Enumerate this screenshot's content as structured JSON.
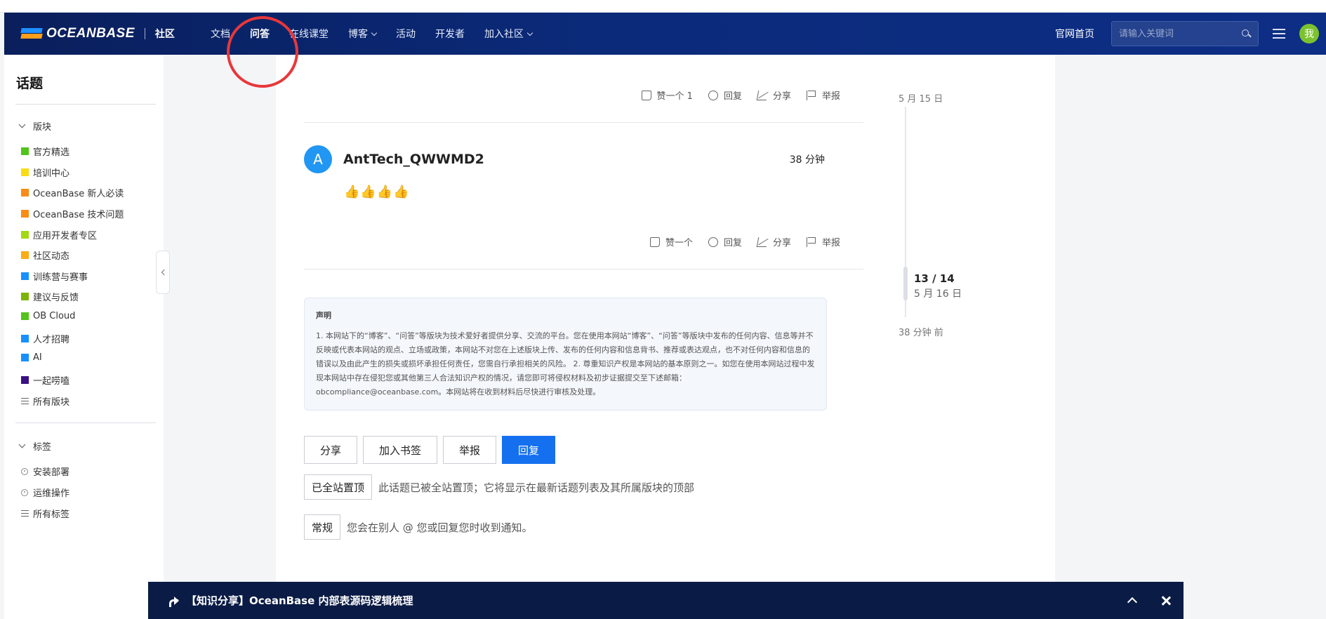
{
  "header": {
    "logo_text": "OCEANBASE",
    "community_label": "社区",
    "nav": [
      {
        "label": "文档",
        "dropdown": false,
        "active": false
      },
      {
        "label": "问答",
        "dropdown": false,
        "active": true
      },
      {
        "label": "在线课堂",
        "dropdown": false,
        "active": false
      },
      {
        "label": "博客",
        "dropdown": true,
        "active": false
      },
      {
        "label": "活动",
        "dropdown": false,
        "active": false
      },
      {
        "label": "开发者",
        "dropdown": false,
        "active": false
      },
      {
        "label": "加入社区",
        "dropdown": true,
        "active": false
      }
    ],
    "home_link": "官网首页",
    "search_placeholder": "请输入关键词",
    "user_avatar": "我"
  },
  "sidebar": {
    "title": "话题",
    "sections_label": "版块",
    "categories": [
      {
        "label": "官方精选",
        "color": "#52c41a"
      },
      {
        "label": "培训中心",
        "color": "#fadb14"
      },
      {
        "label": "OceanBase 新人必读",
        "color": "#fa8c16"
      },
      {
        "label": "OceanBase 技术问题",
        "color": "#fa8c16"
      },
      {
        "label": "应用开发者专区",
        "color": "#a0d911"
      },
      {
        "label": "社区动态",
        "color": "#faad14"
      },
      {
        "label": "训练营与赛事",
        "color": "#1890ff"
      },
      {
        "label": "建议与反馈",
        "color": "#7cb305"
      },
      {
        "label": "OB Cloud",
        "color": "#52c41a"
      },
      {
        "label": "人才招聘",
        "color": "#1890ff"
      },
      {
        "label": "AI",
        "color": "#1890ff"
      },
      {
        "label": "一起唠嗑",
        "color": "#391085"
      }
    ],
    "all_categories": "所有版块",
    "tags_label": "标签",
    "tags": [
      "安装部署",
      "运维操作"
    ],
    "all_tags": "所有标签"
  },
  "post_top_actions": {
    "like": "赞一个 1",
    "reply": "回复",
    "share": "分享",
    "report": "举报"
  },
  "post": {
    "avatar_letter": "A",
    "author": "AntTech_QWWMD2",
    "time": "38 分钟",
    "body": "👍👍👍👍",
    "actions": {
      "like": "赞一个",
      "reply": "回复",
      "share": "分享",
      "report": "举报"
    }
  },
  "notice": {
    "title": "声明",
    "text": "1. 本网站下的“博客”、“问答”等版块为技术爱好者提供分享、交流的平台。您在使用本网站“博客”、“问答”等版块中发布的任何内容、信息等并不反映或代表本网站的观点、立场或政策，本网站不对您在上述版块上传、发布的任何内容和信息背书、推荐或表达观点，也不对任何内容和信息的错误以及由此产生的损失或损坏承担任何责任，您需自行承担相关的风险。 2. 尊重知识产权是本网站的基本原则之一。如您在使用本网站过程中发现本网站中存在侵犯您或其他第三人合法知识产权的情况，请您即可将侵权材料及初步证据提交至下述邮箱：obcompliance@oceanbase.com。本网站将在收到材料后尽快进行审核及处理。"
  },
  "buttons": {
    "share": "分享",
    "bookmark": "加入书签",
    "report": "举报",
    "reply": "回复"
  },
  "pinned": {
    "badge": "已全站置顶",
    "desc": "此话题已被全站置顶；它将显示在最新话题列表及其所属版块的顶部"
  },
  "notification": {
    "badge": "常规",
    "desc": "您会在别人 @ 您或回复您时收到通知。"
  },
  "timeline": {
    "start_date": "5 月 15 日",
    "position": "13 / 14",
    "current_date": "5 月 16 日",
    "end_label": "38 分钟 前"
  },
  "bottom_bar": {
    "title": "【知识分享】OceanBase 内部表源码逻辑梳理"
  }
}
